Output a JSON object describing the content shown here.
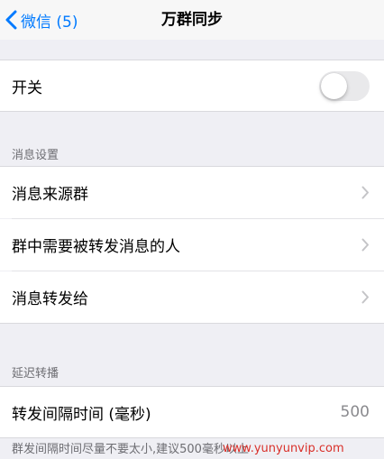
{
  "nav": {
    "back_label": "微信 (5)",
    "title": "万群同步"
  },
  "switch_cell": {
    "label": "开关",
    "value": "off"
  },
  "section_message_settings": {
    "header": "消息设置",
    "items": [
      {
        "label": "消息来源群"
      },
      {
        "label": "群中需要被转发消息的人"
      },
      {
        "label": "消息转发给"
      }
    ]
  },
  "section_delay": {
    "header": "延迟转播",
    "interval_label": "转发间隔时间 (毫秒)",
    "interval_value": "500",
    "footer": "群发间隔时间尽量不要太小,建议500毫秒以上"
  },
  "watermark": "www.yunyunvip.com",
  "colors": {
    "accent": "#007aff",
    "background": "#efeff4",
    "toggle_off": "#e9e9eb",
    "watermark": "#d9302a"
  }
}
